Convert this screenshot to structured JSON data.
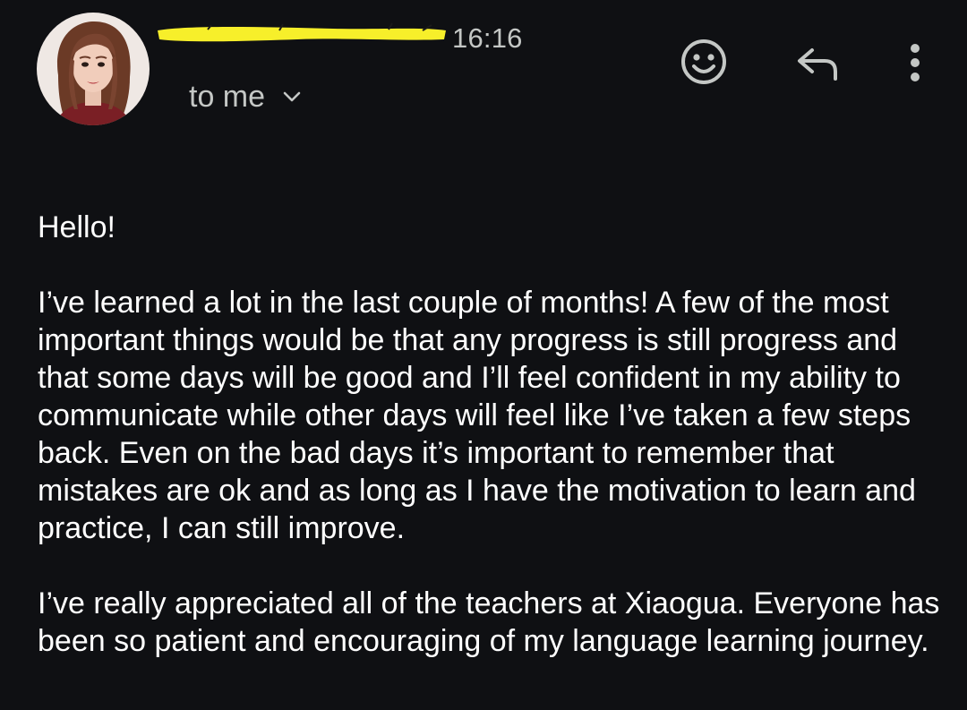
{
  "header": {
    "time": "16:16",
    "recipient_label": "to me",
    "redaction_color": "#f7ef2a"
  },
  "icons": {
    "avatar": "avatar-photo",
    "expand": "chevron-down-icon",
    "emoji": "add-emoji-reaction-icon",
    "reply": "reply-icon",
    "more": "more-vert-icon"
  },
  "message": {
    "greeting": "Hello!",
    "paragraphs": [
      "I’ve learned a lot in the last couple of months! A few of the most important things would be that any progress is still progress and that some days will be good and I’ll feel confident in my ability to communicate while other days will feel like I’ve taken a few steps back. Even on the bad days it’s important to remember that mistakes are ok and as long as I have the motivation to learn and practice, I can still improve.",
      "I’ve really appreciated all of the teachers at Xiaogua. Everyone has been so patient and encouraging of my language learning journey."
    ]
  },
  "colors": {
    "background": "#0f1013",
    "text_primary": "#ffffff",
    "text_secondary": "#c4c7c5"
  }
}
